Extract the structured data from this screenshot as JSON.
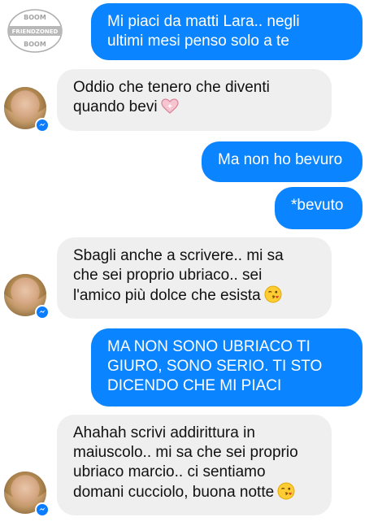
{
  "watermark": {
    "top_text": "BOOM",
    "middle_text": "FRIENDZONED",
    "bottom_text": "BOOM"
  },
  "messages": [
    {
      "from": "me",
      "lines": [
        "Mi piaci da matti Lara.. negli",
        "ultimi mesi penso solo a te"
      ]
    },
    {
      "from": "them",
      "lines": [
        "Oddio che tenero che diventi",
        "quando bevi"
      ],
      "emoji": "sparkling-heart"
    },
    {
      "from": "me",
      "lines": [
        "Ma non ho bevuro"
      ]
    },
    {
      "from": "me",
      "lines": [
        "*bevuto"
      ]
    },
    {
      "from": "them",
      "lines": [
        "Sbagli anche a scrivere.. mi sa",
        "che sei proprio ubriaco.. sei",
        "l'amico più dolce che esista"
      ],
      "emoji": "winking-kiss-face"
    },
    {
      "from": "me",
      "lines": [
        "MA NON SONO UBRIACO TI",
        "GIURO, SONO SERIO. TI STO",
        "DICENDO CHE MI PIACI"
      ]
    },
    {
      "from": "them",
      "lines": [
        "Ahahah scrivi addirittura in",
        "maiuscolo.. mi sa che sei proprio",
        "ubriaco marcio.. ci sentiamo",
        "domani cucciolo, buona notte"
      ],
      "emoji": "winking-kiss-face"
    }
  ],
  "colors": {
    "outgoing_bubble": "#0b84ff",
    "incoming_bubble": "#efeff0",
    "messenger_badge": "#0a7cff"
  }
}
